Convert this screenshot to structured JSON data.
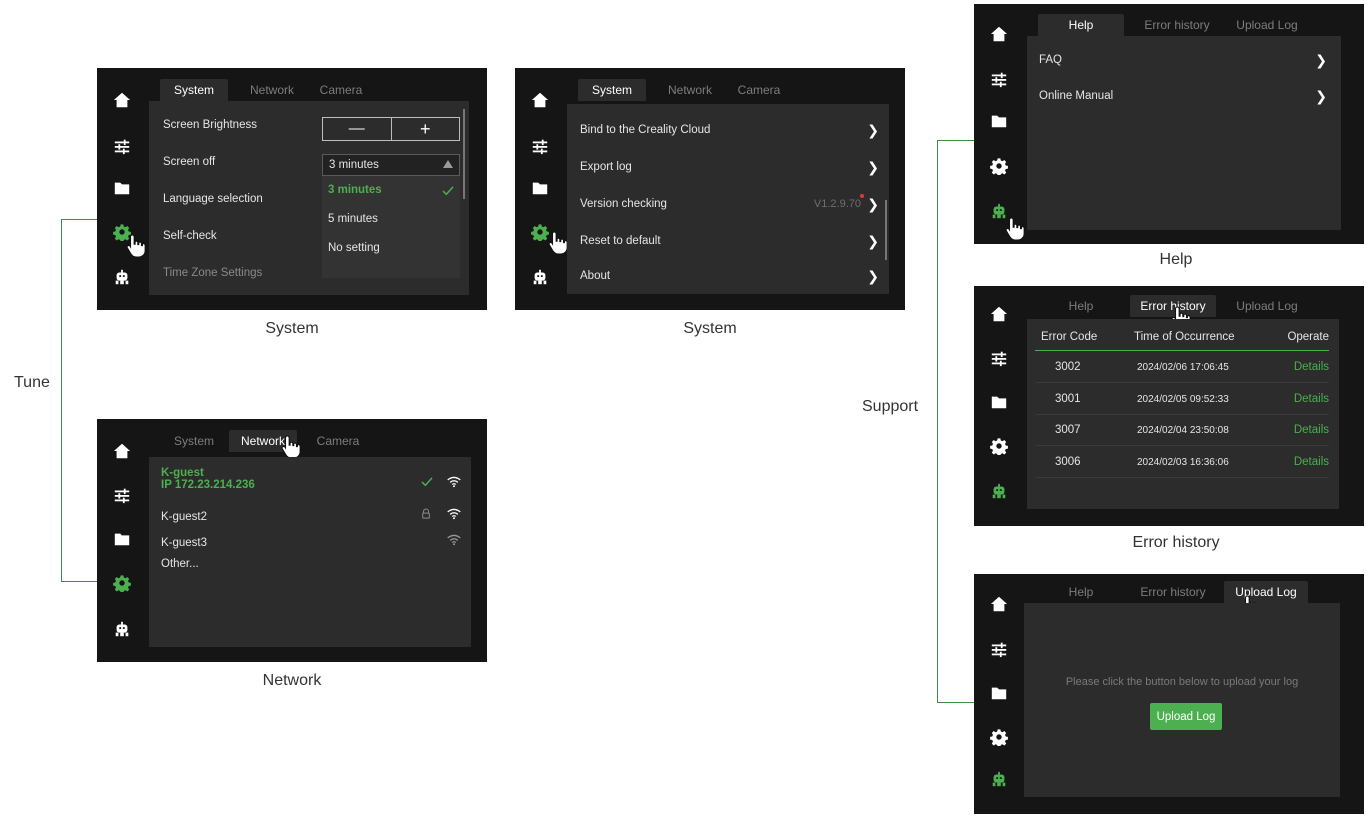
{
  "labels": {
    "tune": "Tune",
    "support": "Support"
  },
  "captions": {
    "system1": "System",
    "system2": "System",
    "network": "Network",
    "help": "Help",
    "error_history": "Error history"
  },
  "settings_tabs": [
    "System",
    "Network",
    "Camera"
  ],
  "support_tabs": [
    "Help",
    "Error history",
    "Upload Log"
  ],
  "system_screen_1": {
    "rows": [
      "Screen Brightness",
      "Screen off",
      "Language selection",
      "Self-check",
      "Time Zone Settings"
    ],
    "brightness": {
      "minus": "—",
      "plus": "+"
    },
    "dropdown": {
      "selected": "3 minutes",
      "options": [
        "3 minutes",
        "5 minutes",
        "No setting"
      ]
    }
  },
  "system_screen_2": {
    "rows": [
      {
        "label": "Bind to the Creality Cloud"
      },
      {
        "label": "Export log"
      },
      {
        "label": "Version checking",
        "value": "V1.2.9.70"
      },
      {
        "label": "Reset to default"
      },
      {
        "label": "About"
      }
    ]
  },
  "network_screen": {
    "networks": [
      {
        "name": "K-guest",
        "ip": "IP 172.23.214.236",
        "connected": true
      },
      {
        "name": "K-guest2",
        "locked": true
      },
      {
        "name": "K-guest3"
      },
      {
        "name": "Other..."
      }
    ]
  },
  "help_screen": {
    "items": [
      "FAQ",
      "Online Manual"
    ]
  },
  "error_screen": {
    "headers": [
      "Error Code",
      "Time of Occurrence",
      "Operate"
    ],
    "rows": [
      {
        "code": "3002",
        "time": "2024/02/06 17:06:45",
        "action": "Details"
      },
      {
        "code": "3001",
        "time": "2024/02/05 09:52:33",
        "action": "Details"
      },
      {
        "code": "3007",
        "time": "2024/02/04 23:50:08",
        "action": "Details"
      },
      {
        "code": "3006",
        "time": "2024/02/03 16:36:06",
        "action": "Details"
      }
    ]
  },
  "upload_screen": {
    "message": "Please click the button below to upload your log",
    "button": "Upload Log"
  },
  "colors": {
    "accent": "#4caf50",
    "screen_bg": "#151515",
    "panel_bg": "#2c2c2c"
  },
  "icons": [
    "home-icon",
    "tune-sliders-icon",
    "folder-icon",
    "gear-icon",
    "robot-support-icon",
    "pointer-hand-icon",
    "wifi-icon",
    "lock-icon",
    "check-icon",
    "chevron-right-icon"
  ]
}
